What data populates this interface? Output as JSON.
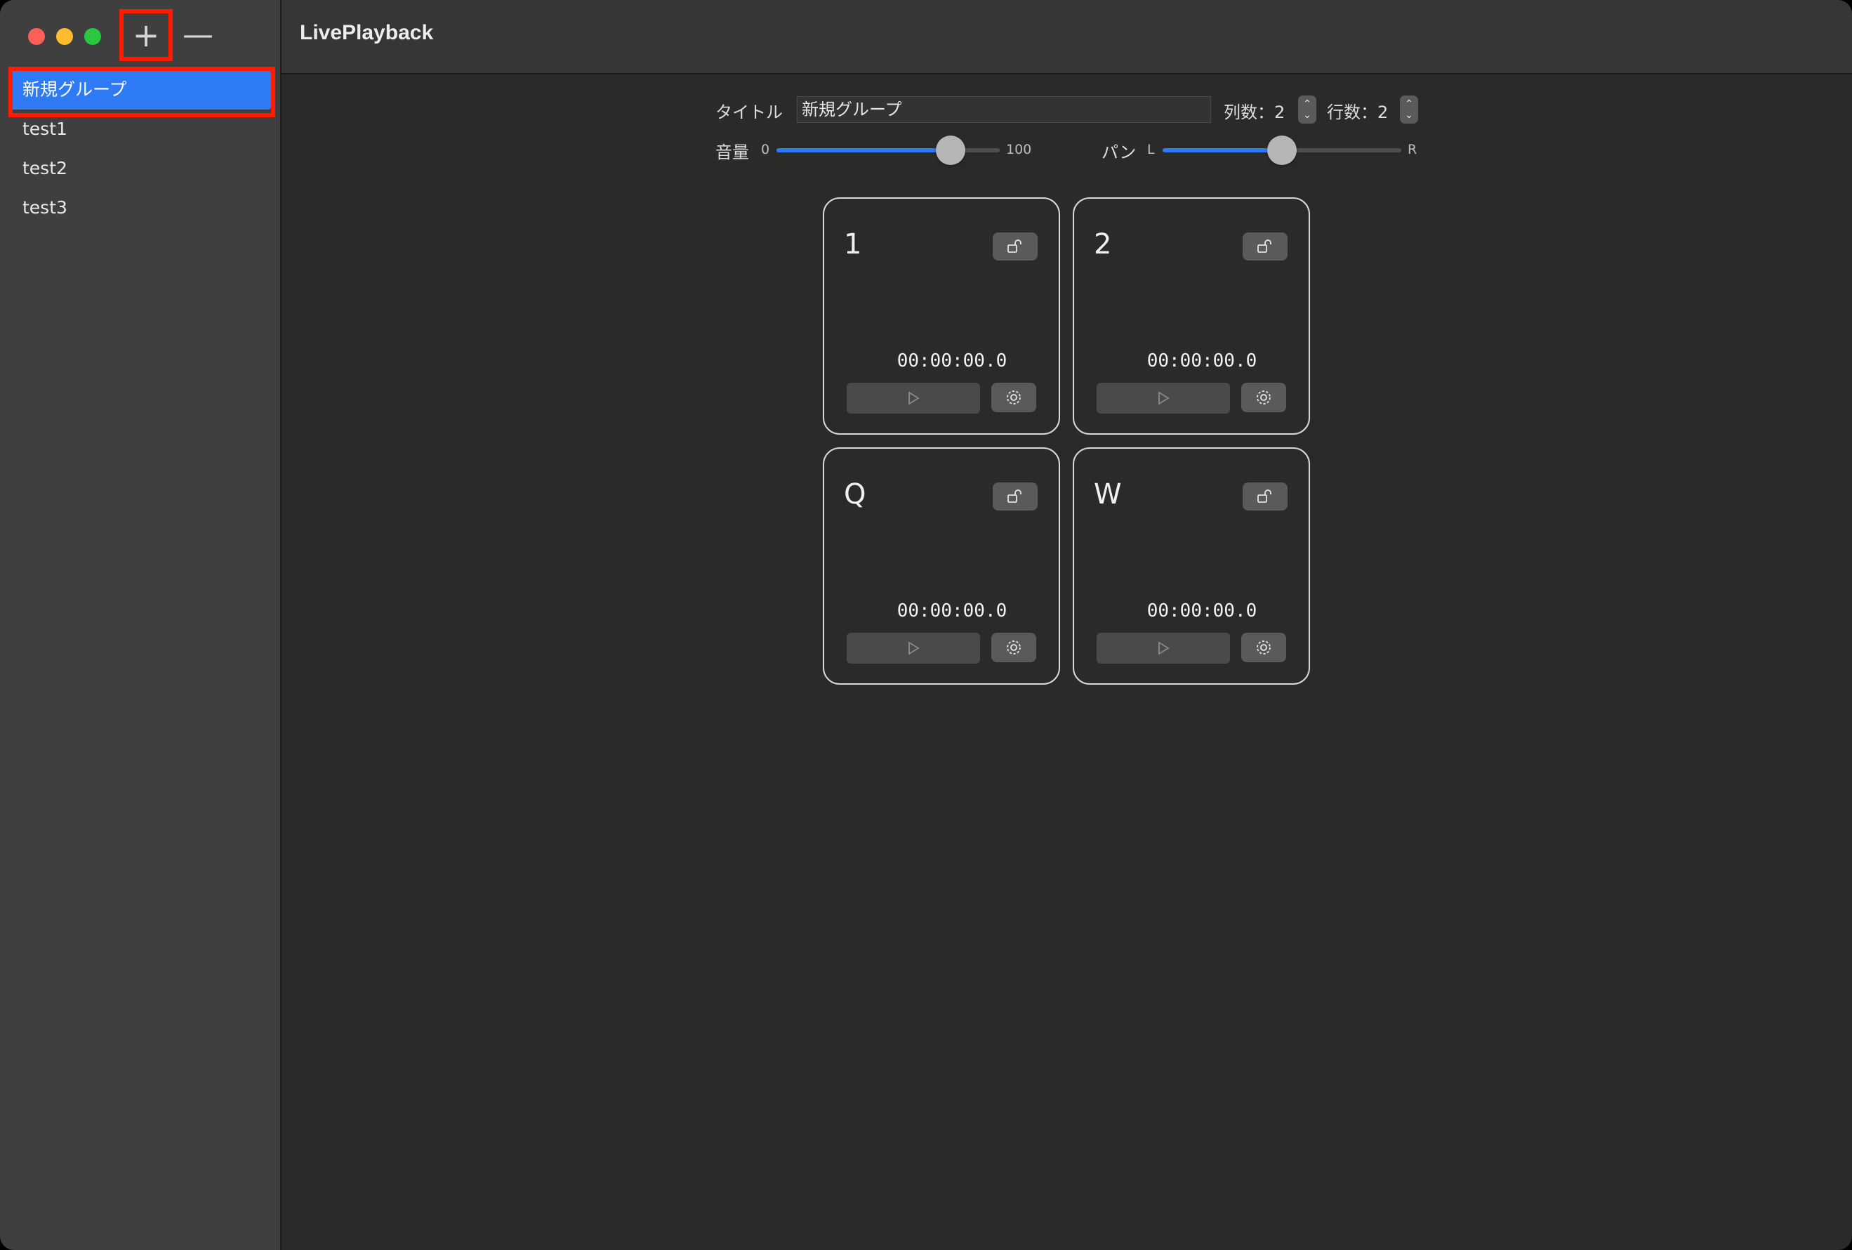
{
  "window": {
    "add_label": "+",
    "remove_label": "—"
  },
  "sidebar": {
    "items": [
      {
        "label": "新規グループ"
      },
      {
        "label": "test1"
      },
      {
        "label": "test2"
      },
      {
        "label": "test3"
      }
    ],
    "selected": "新規グループ"
  },
  "toolbar": {
    "title": "LivePlayback"
  },
  "group": {
    "title_label": "タイトル",
    "title_value": "新規グループ",
    "columns_label": "列数：2",
    "rows_label": "行数：2",
    "volume_label": "音量",
    "volume_min": "0",
    "volume_max": "100",
    "volume_value": 78,
    "pan_label": "パン",
    "pan_left": "L",
    "pan_right": "R",
    "pan_value": 0.5
  },
  "pads": [
    {
      "key": "1",
      "time": "00:00:00.0",
      "lock_icon": "unlock-icon",
      "play_icon": "play-icon",
      "settings_icon": "gear-icon"
    },
    {
      "key": "2",
      "time": "00:00:00.0",
      "lock_icon": "unlock-icon",
      "play_icon": "play-icon",
      "settings_icon": "gear-icon"
    },
    {
      "key": "Q",
      "time": "00:00:00.0",
      "lock_icon": "unlock-icon",
      "play_icon": "play-icon",
      "settings_icon": "gear-icon"
    },
    {
      "key": "W",
      "time": "00:00:00.0",
      "lock_icon": "unlock-icon",
      "play_icon": "play-icon",
      "settings_icon": "gear-icon"
    }
  ],
  "colors": {
    "accent": "#2e7bf5",
    "highlight": "#ff1a00",
    "close": "#fe5f57",
    "minimize": "#febc2e",
    "zoom": "#28c840"
  }
}
